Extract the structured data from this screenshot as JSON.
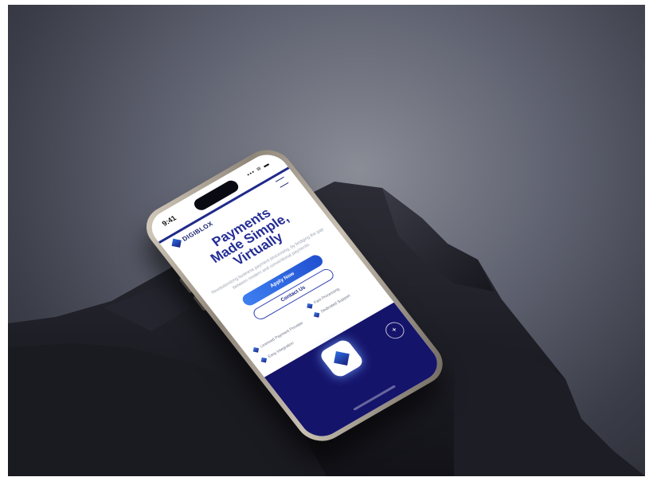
{
  "status": {
    "time": "9:41",
    "icons": "••• ≋ ▬"
  },
  "brand": {
    "name": "DIGIBLOX",
    "accent": "#222d95",
    "button_blue": "#2f63e0",
    "footer_navy": "#15146b"
  },
  "hero": {
    "title_line1": "Payments",
    "title_line2": "Made Simple,",
    "title_line3": "Virtually",
    "subtitle": "Revolutionizing business payment processing, by bridging the gap between modern and conventional payments."
  },
  "buttons": {
    "apply": "Apply Now",
    "contact": "Contact Us"
  },
  "features": [
    "Fast Processing",
    "Licensed Payment Provider",
    "Dedicated Support",
    "Easy Integration"
  ],
  "icons": {
    "logo": "diamond-logo-icon",
    "menu": "hamburger-menu-icon",
    "feature": "diamond-bullet-icon",
    "footer_action": "plus-icon"
  }
}
